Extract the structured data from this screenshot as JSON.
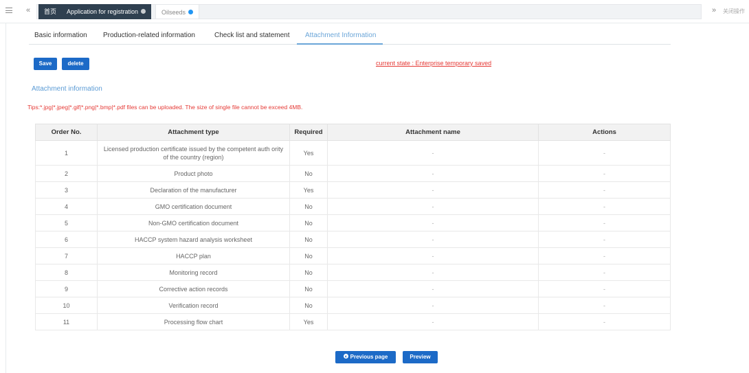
{
  "topbar": {
    "tabs": [
      {
        "label": "首页"
      },
      {
        "label": "Application for registration"
      },
      {
        "label": "Oilseeds"
      }
    ],
    "close_ops": "关闭操作"
  },
  "subtabs": [
    {
      "label": "Basic information"
    },
    {
      "label": "Production-related information"
    },
    {
      "label": "Check list and statement"
    },
    {
      "label": "Attachment Information"
    }
  ],
  "toolbar": {
    "save_label": "Save",
    "delete_label": "delete"
  },
  "status": {
    "text": "current state : Enterprise temporary saved"
  },
  "section": {
    "title": "Attachment information"
  },
  "tips": "Tips:*.jpg|*.jpeg|*.gif|*.png|*.bmp|*.pdf files can be uploaded. The size of single file cannot be exceed 4MB.",
  "table": {
    "headers": [
      "Order No.",
      "Attachment type",
      "Required",
      "Attachment name",
      "Actions"
    ],
    "rows": [
      {
        "no": "1",
        "type": "Licensed production certificate issued by the competent auth ority of the country (region)",
        "required": "Yes",
        "name": "-",
        "actions": "-"
      },
      {
        "no": "2",
        "type": "Product photo",
        "required": "No",
        "name": "-",
        "actions": "-"
      },
      {
        "no": "3",
        "type": "Declaration of the manufacturer",
        "required": "Yes",
        "name": "-",
        "actions": "-"
      },
      {
        "no": "4",
        "type": "GMO certification document",
        "required": "No",
        "name": "-",
        "actions": "-"
      },
      {
        "no": "5",
        "type": "Non-GMO certification document",
        "required": "No",
        "name": "-",
        "actions": "-"
      },
      {
        "no": "6",
        "type": "HACCP system hazard analysis worksheet",
        "required": "No",
        "name": "-",
        "actions": "-"
      },
      {
        "no": "7",
        "type": "HACCP plan",
        "required": "No",
        "name": "-",
        "actions": "-"
      },
      {
        "no": "8",
        "type": "Monitoring record",
        "required": "No",
        "name": "-",
        "actions": "-"
      },
      {
        "no": "9",
        "type": "Corrective action records",
        "required": "No",
        "name": "-",
        "actions": "-"
      },
      {
        "no": "10",
        "type": "Verification record",
        "required": "No",
        "name": "-",
        "actions": "-"
      },
      {
        "no": "11",
        "type": "Processing flow chart",
        "required": "Yes",
        "name": "-",
        "actions": "-"
      }
    ]
  },
  "footer": {
    "prev_label": "Previous page",
    "preview_label": "Preview"
  },
  "colors": {
    "primary_button": "#1c6ac7",
    "tab_dark": "#2f4050",
    "active_tab": "#6aa5d8",
    "alert_red": "#e53935"
  }
}
